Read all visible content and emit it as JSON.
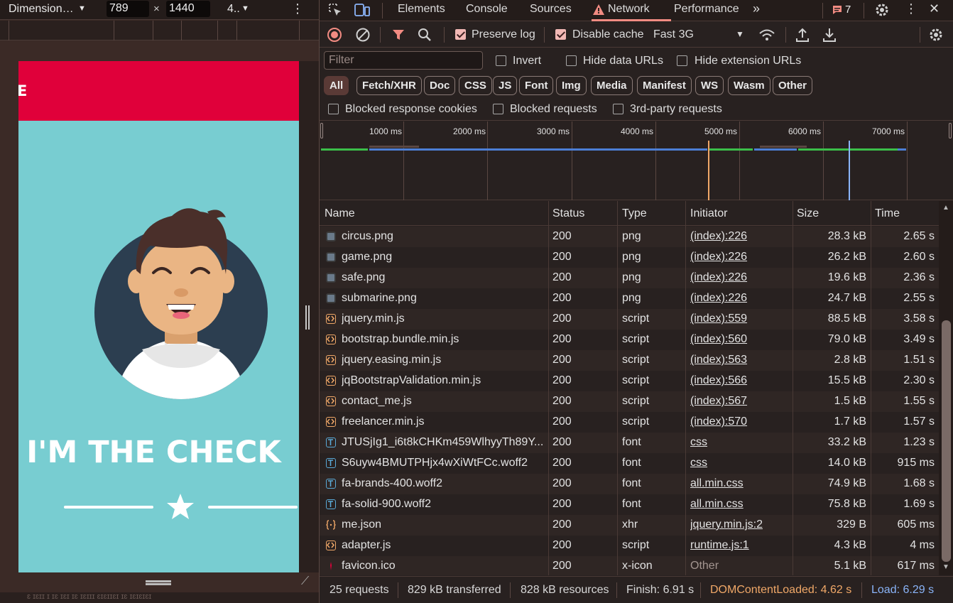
{
  "device_toolbar": {
    "device": "Dimension…",
    "width": "789",
    "height": "1440",
    "times": "×",
    "zoom": "4.."
  },
  "emulated_page": {
    "brand": "E",
    "masthead": ", I'M THE CHECK"
  },
  "page_bottom_text": "ɛ ɪɛɪɪ   ɪ ɪɛ ɪɛɪ   ɪɛ ɪɛɪɪɪ ɛɪɛɪɪɛɪ   ɪɛ ɪɛɪɛɪɛɪ",
  "devtools": {
    "tabs": [
      "Elements",
      "Console",
      "Sources",
      "Network",
      "Performance"
    ],
    "active_tab": "Network",
    "issues_count": "7",
    "toolbar": {
      "preserve_log": "Preserve log",
      "disable_cache": "Disable cache",
      "throttle": "Fast 3G"
    },
    "filter": {
      "placeholder": "Filter",
      "invert": "Invert",
      "hide_data_urls": "Hide data URLs",
      "hide_extension_urls": "Hide extension URLs"
    },
    "type_filters": [
      "All",
      "Fetch/XHR",
      "Doc",
      "CSS",
      "JS",
      "Font",
      "Img",
      "Media",
      "Manifest",
      "WS",
      "Wasm",
      "Other"
    ],
    "blocked": {
      "cookies": "Blocked response cookies",
      "requests": "Blocked requests",
      "third_party": "3rd-party requests"
    },
    "overview_ticks": [
      "1000 ms",
      "2000 ms",
      "3000 ms",
      "4000 ms",
      "5000 ms",
      "6000 ms",
      "7000 ms"
    ],
    "columns": [
      "Name",
      "Status",
      "Type",
      "Initiator",
      "Size",
      "Time"
    ],
    "rows": [
      {
        "name": "circus.png",
        "status": "200",
        "type": "png",
        "initiator": "(index):226",
        "size": "28.3 kB",
        "time": "2.65 s",
        "icon": "image-icon"
      },
      {
        "name": "game.png",
        "status": "200",
        "type": "png",
        "initiator": "(index):226",
        "size": "26.2 kB",
        "time": "2.60 s",
        "icon": "image-icon"
      },
      {
        "name": "safe.png",
        "status": "200",
        "type": "png",
        "initiator": "(index):226",
        "size": "19.6 kB",
        "time": "2.36 s",
        "icon": "image-icon"
      },
      {
        "name": "submarine.png",
        "status": "200",
        "type": "png",
        "initiator": "(index):226",
        "size": "24.7 kB",
        "time": "2.55 s",
        "icon": "image-icon"
      },
      {
        "name": "jquery.min.js",
        "status": "200",
        "type": "script",
        "initiator": "(index):559",
        "size": "88.5 kB",
        "time": "3.58 s",
        "icon": "script-icon"
      },
      {
        "name": "bootstrap.bundle.min.js",
        "status": "200",
        "type": "script",
        "initiator": "(index):560",
        "size": "79.0 kB",
        "time": "3.49 s",
        "icon": "script-icon"
      },
      {
        "name": "jquery.easing.min.js",
        "status": "200",
        "type": "script",
        "initiator": "(index):563",
        "size": "2.8 kB",
        "time": "1.51 s",
        "icon": "script-icon"
      },
      {
        "name": "jqBootstrapValidation.min.js",
        "status": "200",
        "type": "script",
        "initiator": "(index):566",
        "size": "15.5 kB",
        "time": "2.30 s",
        "icon": "script-icon"
      },
      {
        "name": "contact_me.js",
        "status": "200",
        "type": "script",
        "initiator": "(index):567",
        "size": "1.5 kB",
        "time": "1.55 s",
        "icon": "script-icon"
      },
      {
        "name": "freelancer.min.js",
        "status": "200",
        "type": "script",
        "initiator": "(index):570",
        "size": "1.7 kB",
        "time": "1.57 s",
        "icon": "script-icon"
      },
      {
        "name": "JTUSjIg1_i6t8kCHKm459WlhyyTh89Y....",
        "status": "200",
        "type": "font",
        "initiator": "css",
        "size": "33.2 kB",
        "time": "1.23 s",
        "icon": "font-icon"
      },
      {
        "name": "S6uyw4BMUTPHjx4wXiWtFCc.woff2",
        "status": "200",
        "type": "font",
        "initiator": "css",
        "size": "14.0 kB",
        "time": "915 ms",
        "icon": "font-icon"
      },
      {
        "name": "fa-brands-400.woff2",
        "status": "200",
        "type": "font",
        "initiator": "all.min.css",
        "size": "74.9 kB",
        "time": "1.68 s",
        "icon": "font-icon"
      },
      {
        "name": "fa-solid-900.woff2",
        "status": "200",
        "type": "font",
        "initiator": "all.min.css",
        "size": "75.8 kB",
        "time": "1.69 s",
        "icon": "font-icon"
      },
      {
        "name": "me.json",
        "status": "200",
        "type": "xhr",
        "initiator": "jquery.min.js:2",
        "size": "329 B",
        "time": "605 ms",
        "icon": "json-icon"
      },
      {
        "name": "adapter.js",
        "status": "200",
        "type": "script",
        "initiator": "runtime.js:1",
        "size": "4.3 kB",
        "time": "4 ms",
        "icon": "script-icon"
      },
      {
        "name": "favicon.ico",
        "status": "200",
        "type": "x-icon",
        "initiator": "Other",
        "size": "5.1 kB",
        "time": "617 ms",
        "icon": "favicon-icon"
      }
    ],
    "status_bar": {
      "requests": "25 requests",
      "transferred": "829 kB transferred",
      "resources": "828 kB resources",
      "finish": "Finish: 6.91 s",
      "dom_content_loaded": "DOMContentLoaded: 4.62 s",
      "load": "Load: 6.29 s"
    }
  },
  "colors": {
    "accent_network": "#f28b82",
    "dom_content_loaded": "#f0a868",
    "load": "#8ab4f8",
    "site_nav": "#e0003a",
    "site_bg": "#78cdd1"
  }
}
